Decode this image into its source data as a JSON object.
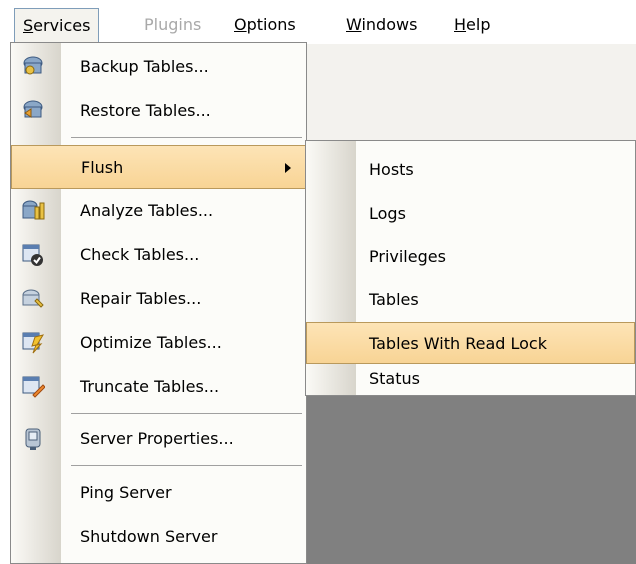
{
  "menubar": {
    "services": {
      "label": "Services",
      "mnemonic": "S",
      "rest": "ervices"
    },
    "plugins": {
      "label": "Plugins"
    },
    "options": {
      "label": "Options",
      "mnemonic": "O",
      "rest": "ptions"
    },
    "windows": {
      "label": "Windows",
      "mnemonic": "W",
      "rest": "indows"
    },
    "help": {
      "label": "Help",
      "mnemonic": "H",
      "rest": "elp"
    }
  },
  "services_menu": {
    "items": [
      {
        "label": "Backup Tables...",
        "icon": "backup-tables-icon"
      },
      {
        "label": "Restore Tables...",
        "icon": "restore-tables-icon"
      },
      {
        "label": "Flush",
        "icon": ""
      },
      {
        "label": "Analyze Tables...",
        "icon": "analyze-tables-icon"
      },
      {
        "label": "Check Tables...",
        "icon": "check-tables-icon"
      },
      {
        "label": "Repair Tables...",
        "icon": "repair-tables-icon"
      },
      {
        "label": "Optimize Tables...",
        "icon": "optimize-tables-icon"
      },
      {
        "label": "Truncate Tables...",
        "icon": "truncate-tables-icon"
      },
      {
        "label": "Server Properties...",
        "icon": "server-properties-icon"
      },
      {
        "label": "Ping Server",
        "icon": ""
      },
      {
        "label": "Shutdown Server",
        "icon": ""
      }
    ],
    "highlighted": "Flush"
  },
  "flush_submenu": {
    "items": [
      "Hosts",
      "Logs",
      "Privileges",
      "Tables",
      "Tables With Read Lock",
      "Status"
    ],
    "highlighted": "Tables With Read Lock"
  },
  "colors": {
    "highlight": "#fde4b6",
    "highlight_border": "#b9995c",
    "disabled_text": "#a9a9a9"
  }
}
